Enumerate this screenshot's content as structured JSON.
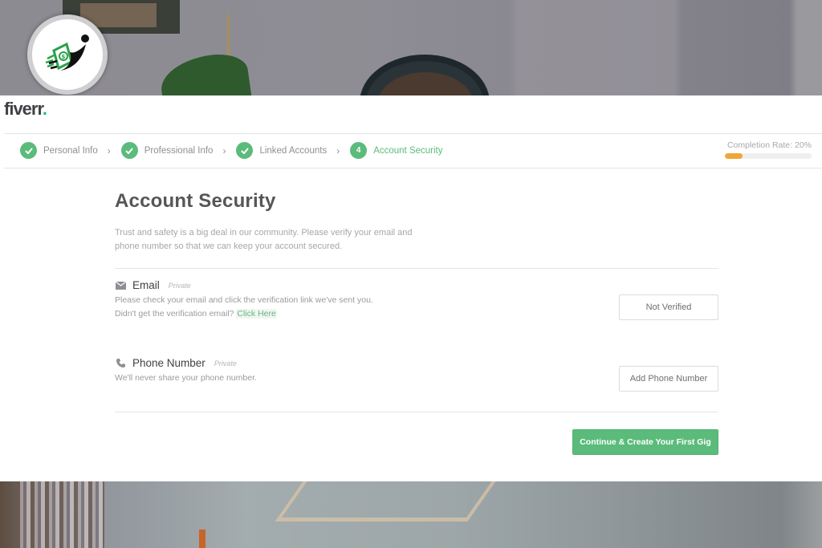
{
  "brand": {
    "name": "fiverr",
    "dot": "."
  },
  "steps": [
    {
      "label": "Personal Info",
      "status": "done",
      "badge_icon": "check-icon"
    },
    {
      "label": "Professional Info",
      "status": "done",
      "badge_icon": "check-icon"
    },
    {
      "label": "Linked Accounts",
      "status": "done",
      "badge_icon": "check-icon"
    },
    {
      "label": "Account Security",
      "status": "active",
      "number": "4"
    }
  ],
  "step_separator": "›",
  "completion": {
    "label": "Completion Rate: 20%",
    "percent": 20
  },
  "page": {
    "title": "Account Security",
    "intro": "Trust and safety is a big deal in our community. Please verify your email and phone number so that we can keep your account secured."
  },
  "email": {
    "icon": "envelope-icon",
    "title": "Email",
    "privacy": "Private",
    "desc_line1": "Please check your email and click the verification link we've sent you.",
    "desc_line2": "Didn't get the verification email?",
    "link": "Click Here",
    "button": "Not Verified"
  },
  "phone": {
    "icon": "phone-icon",
    "title": "Phone Number",
    "privacy": "Private",
    "desc": "We'll never share your phone number.",
    "button": "Add Phone Number"
  },
  "continue_button": "Continue & Create Your First Gig",
  "colors": {
    "accent": "#5bbb7b",
    "progress": "#f0a637",
    "brand_dot": "#1dbf73"
  }
}
